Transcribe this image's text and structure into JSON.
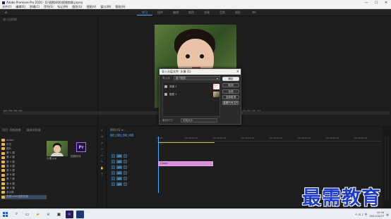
{
  "window": {
    "title": "Adobe Premiere Pro 2020 - D:\\视频\\000\\视频剪辑.prproj",
    "controls": [
      "—",
      "☐",
      "✕"
    ]
  },
  "menu": [
    "文件(F)",
    "编辑(E)",
    "剪辑(C)",
    "序列(S)",
    "标记(M)",
    "图形(G)",
    "视图(V)",
    "窗口(W)",
    "帮助(H)"
  ],
  "workspace": {
    "tabs": [
      "学习",
      "组件",
      "编辑",
      "颜色",
      "效果",
      "音频",
      "图形",
      "库"
    ],
    "active": 0
  },
  "source": {
    "tab": "源:(无剪辑)",
    "tc_left": "00;00;00;00",
    "tc_right": "00;00;00;00"
  },
  "program": {
    "tc_left": "00;00;00;00",
    "tc_right": "00;00;05;02"
  },
  "dialog": {
    "title": "导入分层文件: 头像 (1)",
    "select_label": "导入为",
    "select_value": "各个图层",
    "layers": [
      {
        "label": "背景 1",
        "checked": true
      },
      {
        "label": "图层 1",
        "checked": true
      }
    ],
    "buttons": [
      "确定",
      "取消",
      "全选",
      "全部取消",
      "重置所有文件"
    ],
    "footer_label": "素材尺寸:",
    "footer_value": "文档大小"
  },
  "project": {
    "tabs": [
      "项目: 视频剪辑",
      "媒体浏览器"
    ],
    "tree": [
      "Anton",
      "中文",
      "图片",
      "第 1 课",
      "第 2 课",
      "第 3 课",
      "第 4 课",
      "第 5 课",
      "第 6 课",
      "第 7 课",
      "第 8 课",
      "第 9 课",
      "未分类",
      "视频1000视频剪辑"
    ],
    "selected": 13,
    "bins": [
      {
        "label": "头像.jpg",
        "type": "image"
      },
      {
        "label": "视频序列",
        "type": "prproj",
        "badge": "Pr"
      }
    ]
  },
  "timeline": {
    "name": "序列 01 ≡",
    "timecode": "00;00;00;00",
    "ruler": [
      "00;00",
      "00;00;04;29",
      "00;00;09;29",
      "00;00;14;29",
      "00;00;19;29",
      "00;00;24;29",
      "00;00;29;29",
      "00;00;34;28"
    ],
    "tracks": [
      "V3",
      "V2",
      "V1",
      "A1",
      "A2",
      "A3"
    ],
    "clip": "Clown"
  },
  "watermark": "最需教育",
  "taskbar": {
    "time": "10:54",
    "date": "2021/10/27",
    "tray": "ヘ  ⊡  ♪  中"
  }
}
